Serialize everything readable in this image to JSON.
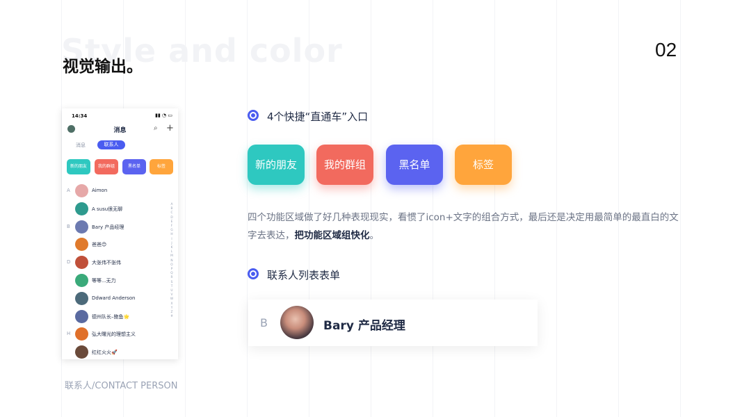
{
  "watermark": "Style and color",
  "page_title": "视觉输出。",
  "page_number": "02",
  "phone": {
    "status_time": "14:34",
    "status_icons": "▮▮ ◔ ▭",
    "title": "消息",
    "search_icon": "⌕",
    "plus_icon": "+",
    "tabs": {
      "messages": "消息",
      "contacts": "联系人"
    },
    "quick_buttons": [
      {
        "label": "新的朋友",
        "color": "#2ec8c0"
      },
      {
        "label": "我的群组",
        "color": "#f26a5e"
      },
      {
        "label": "黑名单",
        "color": "#5b63f0"
      },
      {
        "label": "标签",
        "color": "#ffa53c"
      }
    ],
    "contacts": [
      {
        "letter": "A",
        "name": "Aimon",
        "color": "#e6a8a8"
      },
      {
        "letter": "",
        "name": "A susu很无聊",
        "color": "#2e9a8e"
      },
      {
        "letter": "B",
        "name": "Bary 产品经理",
        "color": "#6c7ab0"
      },
      {
        "letter": "",
        "name": "爸爸😊",
        "color": "#e07a2c"
      },
      {
        "letter": "D",
        "name": "大张伟不张伟",
        "color": "#c0503a"
      },
      {
        "letter": "",
        "name": "等等...无力",
        "color": "#3aaa7a"
      },
      {
        "letter": "",
        "name": "Ddward Anderson",
        "color": "#4c6a7a"
      },
      {
        "letter": "",
        "name": "德州队长–鲍鱼🌟",
        "color": "#5a6aa0"
      },
      {
        "letter": "H",
        "name": "弘大曙光的理想主义",
        "color": "#e0702a"
      },
      {
        "letter": "",
        "name": "红红火火🚀",
        "color": "#6a4a3a"
      }
    ],
    "index_letters": "A\nB\nC\nD\nE\nF\nG\nH\nI\nJ\nK\nL\nM\nN\nO\nP\nQ\nR\nS\nT\nU\nV\nW\nX\nY\nZ\n#"
  },
  "caption": "联系人/CONTACT PERSON",
  "section1": {
    "heading": "4个快捷“直通车”入口",
    "buttons": [
      {
        "label": "新的朋友",
        "color": "#2ec8c0"
      },
      {
        "label": "我的群组",
        "color": "#f26a5e"
      },
      {
        "label": "黑名单",
        "color": "#5b63f0"
      },
      {
        "label": "标签",
        "color": "#ffa53c"
      }
    ]
  },
  "description": {
    "text": "四个功能区域做了好几种表现现实，看惯了icon+文字的组合方式，最后还是决定用最简单的最直白的文字去表达，",
    "bold": "把功能区域组快化",
    "end": "。"
  },
  "section2": {
    "heading": "联系人列表表单",
    "card_letter": "B",
    "card_name": "Bary 产品经理"
  },
  "colors": {
    "accent": "#4a5cf0"
  }
}
